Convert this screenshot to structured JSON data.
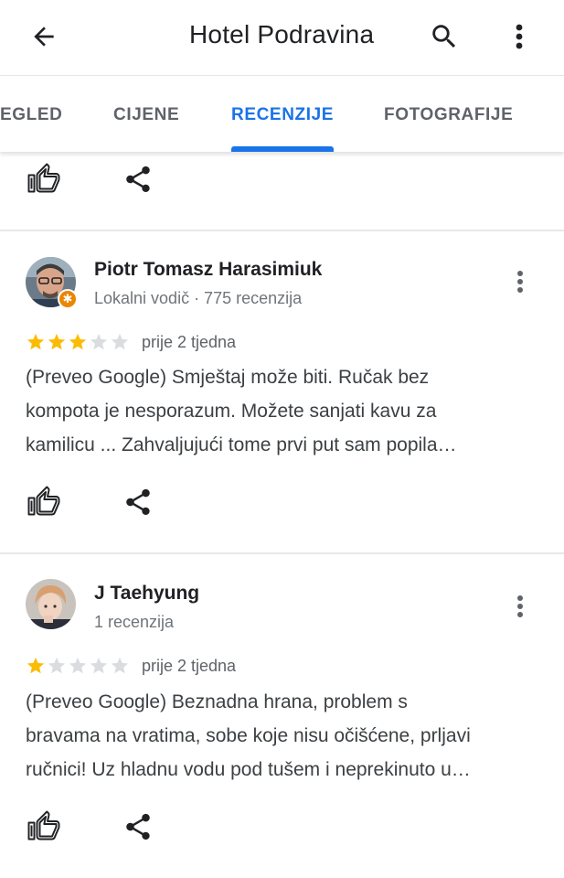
{
  "header": {
    "title": "Hotel Podravina",
    "back_icon": "arrow-back-icon",
    "search_icon": "search-icon",
    "more_icon": "more-vert-icon"
  },
  "tabs": [
    {
      "label": "EGLED",
      "active": false
    },
    {
      "label": "CIJENE",
      "active": false
    },
    {
      "label": "RECENZIJE",
      "active": true
    },
    {
      "label": "FOTOGRAFIJE",
      "active": false
    }
  ],
  "colors": {
    "accent": "#1a73e8",
    "star_filled": "#fbbc04",
    "star_empty": "#dadce0",
    "guide_badge": "#ea8600"
  },
  "reviews": [
    {
      "author": "Piotr Tomasz Harasimiuk",
      "meta": "Lokalni vodič · 775 recenzija",
      "rating": 3,
      "max_rating": 5,
      "when": "prije 2 tjedna",
      "text_lines": [
        "(Preveo Google) Smještaj može biti. Ručak bez",
        "kompota je nesporazum. Možete sanjati kavu za",
        "kamilicu ... Zahvaljujući tome prvi put sam popila…"
      ]
    },
    {
      "author": "J Taehyung",
      "meta": "1 recenzija",
      "rating": 1,
      "max_rating": 5,
      "when": "prije 2 tjedna",
      "text_lines": [
        "(Preveo Google) Beznadna hrana, problem s",
        "bravama na vratima, sobe koje nisu očišćene, prljavi",
        "ručnici! Uz hladnu vodu pod tušem i neprekinuto u…"
      ]
    }
  ],
  "actions": {
    "like_icon": "thumb-up-icon",
    "share_icon": "share-icon"
  }
}
